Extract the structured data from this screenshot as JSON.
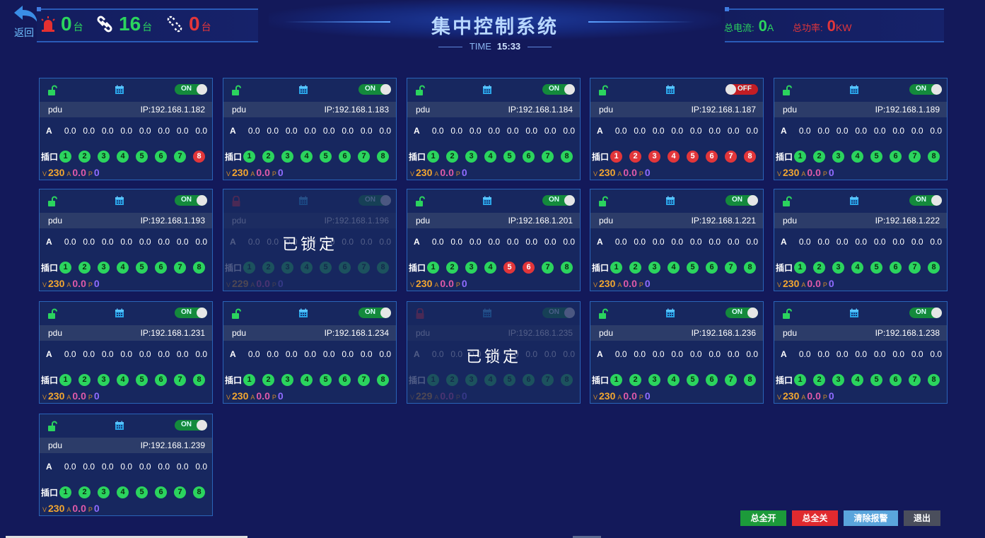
{
  "header": {
    "back_label": "返回",
    "alarm_count": "0",
    "online_count": "16",
    "offline_count": "0",
    "unit": "台",
    "title": "集中控制系统",
    "time_label": "TIME",
    "time_value": "15:33",
    "total_current_label": "总电流:",
    "total_current_value": "0",
    "total_current_unit": "A",
    "total_power_label": "总功率:",
    "total_power_value": "0",
    "total_power_unit": "KW"
  },
  "card_labels": {
    "current_row_label": "A",
    "ports_label": "插口",
    "lock_text": "已锁定",
    "v_unit": "V",
    "a_unit": "A",
    "p_unit": "P"
  },
  "devices": [
    {
      "name": "pdu",
      "ip": "IP:192.168.1.182",
      "switch": "ON",
      "locked": false,
      "currents": [
        "0.0",
        "0.0",
        "0.0",
        "0.0",
        "0.0",
        "0.0",
        "0.0",
        "0.0"
      ],
      "ports_on": [
        true,
        true,
        true,
        true,
        true,
        true,
        true,
        false
      ],
      "voltage": "230",
      "amps": "0.0",
      "power": "0"
    },
    {
      "name": "pdu",
      "ip": "IP:192.168.1.183",
      "switch": "ON",
      "locked": false,
      "currents": [
        "0.0",
        "0.0",
        "0.0",
        "0.0",
        "0.0",
        "0.0",
        "0.0",
        "0.0"
      ],
      "ports_on": [
        true,
        true,
        true,
        true,
        true,
        true,
        true,
        true
      ],
      "voltage": "230",
      "amps": "0.0",
      "power": "0"
    },
    {
      "name": "pdu",
      "ip": "IP:192.168.1.184",
      "switch": "ON",
      "locked": false,
      "currents": [
        "0.0",
        "0.0",
        "0.0",
        "0.0",
        "0.0",
        "0.0",
        "0.0",
        "0.0"
      ],
      "ports_on": [
        true,
        true,
        true,
        true,
        true,
        true,
        true,
        true
      ],
      "voltage": "230",
      "amps": "0.0",
      "power": "0"
    },
    {
      "name": "pdu",
      "ip": "IP:192.168.1.187",
      "switch": "OFF",
      "locked": false,
      "currents": [
        "0.0",
        "0.0",
        "0.0",
        "0.0",
        "0.0",
        "0.0",
        "0.0",
        "0.0"
      ],
      "ports_on": [
        false,
        false,
        false,
        false,
        false,
        false,
        false,
        false
      ],
      "voltage": "230",
      "amps": "0.0",
      "power": "0"
    },
    {
      "name": "pdu",
      "ip": "IP:192.168.1.189",
      "switch": "ON",
      "locked": false,
      "currents": [
        "0.0",
        "0.0",
        "0.0",
        "0.0",
        "0.0",
        "0.0",
        "0.0",
        "0.0"
      ],
      "ports_on": [
        true,
        true,
        true,
        true,
        true,
        true,
        true,
        true
      ],
      "voltage": "230",
      "amps": "0.0",
      "power": "0"
    },
    {
      "name": "pdu",
      "ip": "IP:192.168.1.193",
      "switch": "ON",
      "locked": false,
      "currents": [
        "0.0",
        "0.0",
        "0.0",
        "0.0",
        "0.0",
        "0.0",
        "0.0",
        "0.0"
      ],
      "ports_on": [
        true,
        true,
        true,
        true,
        true,
        true,
        true,
        true
      ],
      "voltage": "230",
      "amps": "0.0",
      "power": "0"
    },
    {
      "name": "pdu",
      "ip": "IP:192.168.1.196",
      "switch": "ON",
      "locked": true,
      "currents": [
        "0.0",
        "0.0",
        "0.0",
        "0.0",
        "0.0",
        "0.0",
        "0.0",
        "0.0"
      ],
      "ports_on": [
        true,
        true,
        true,
        true,
        true,
        true,
        true,
        true
      ],
      "voltage": "229",
      "amps": "0.0",
      "power": "0"
    },
    {
      "name": "pdu",
      "ip": "IP:192.168.1.201",
      "switch": "ON",
      "locked": false,
      "currents": [
        "0.0",
        "0.0",
        "0.0",
        "0.0",
        "0.0",
        "0.0",
        "0.0",
        "0.0"
      ],
      "ports_on": [
        true,
        true,
        true,
        true,
        false,
        false,
        true,
        true
      ],
      "voltage": "230",
      "amps": "0.0",
      "power": "0"
    },
    {
      "name": "pdu",
      "ip": "IP:192.168.1.221",
      "switch": "ON",
      "locked": false,
      "currents": [
        "0.0",
        "0.0",
        "0.0",
        "0.0",
        "0.0",
        "0.0",
        "0.0",
        "0.0"
      ],
      "ports_on": [
        true,
        true,
        true,
        true,
        true,
        true,
        true,
        true
      ],
      "voltage": "230",
      "amps": "0.0",
      "power": "0"
    },
    {
      "name": "pdu",
      "ip": "IP:192.168.1.222",
      "switch": "ON",
      "locked": false,
      "currents": [
        "0.0",
        "0.0",
        "0.0",
        "0.0",
        "0.0",
        "0.0",
        "0.0",
        "0.0"
      ],
      "ports_on": [
        true,
        true,
        true,
        true,
        true,
        true,
        true,
        true
      ],
      "voltage": "230",
      "amps": "0.0",
      "power": "0"
    },
    {
      "name": "pdu",
      "ip": "IP:192.168.1.231",
      "switch": "ON",
      "locked": false,
      "currents": [
        "0.0",
        "0.0",
        "0.0",
        "0.0",
        "0.0",
        "0.0",
        "0.0",
        "0.0"
      ],
      "ports_on": [
        true,
        true,
        true,
        true,
        true,
        true,
        true,
        true
      ],
      "voltage": "230",
      "amps": "0.0",
      "power": "0"
    },
    {
      "name": "pdu",
      "ip": "IP:192.168.1.234",
      "switch": "ON",
      "locked": false,
      "currents": [
        "0.0",
        "0.0",
        "0.0",
        "0.0",
        "0.0",
        "0.0",
        "0.0",
        "0.0"
      ],
      "ports_on": [
        true,
        true,
        true,
        true,
        true,
        true,
        true,
        true
      ],
      "voltage": "230",
      "amps": "0.0",
      "power": "0"
    },
    {
      "name": "pdu",
      "ip": "IP:192.168.1.235",
      "switch": "ON",
      "locked": true,
      "currents": [
        "0.0",
        "0.0",
        "0.0",
        "0.0",
        "0.0",
        "0.0",
        "0.0",
        "0.0"
      ],
      "ports_on": [
        true,
        true,
        true,
        true,
        true,
        true,
        true,
        true
      ],
      "voltage": "229",
      "amps": "0.0",
      "power": "0"
    },
    {
      "name": "pdu",
      "ip": "IP:192.168.1.236",
      "switch": "ON",
      "locked": false,
      "currents": [
        "0.0",
        "0.0",
        "0.0",
        "0.0",
        "0.0",
        "0.0",
        "0.0",
        "0.0"
      ],
      "ports_on": [
        true,
        true,
        true,
        true,
        true,
        true,
        true,
        true
      ],
      "voltage": "230",
      "amps": "0.0",
      "power": "0"
    },
    {
      "name": "pdu",
      "ip": "IP:192.168.1.238",
      "switch": "ON",
      "locked": false,
      "currents": [
        "0.0",
        "0.0",
        "0.0",
        "0.0",
        "0.0",
        "0.0",
        "0.0",
        "0.0"
      ],
      "ports_on": [
        true,
        true,
        true,
        true,
        true,
        true,
        true,
        true
      ],
      "voltage": "230",
      "amps": "0.0",
      "power": "0"
    },
    {
      "name": "pdu",
      "ip": "IP:192.168.1.239",
      "switch": "ON",
      "locked": false,
      "currents": [
        "0.0",
        "0.0",
        "0.0",
        "0.0",
        "0.0",
        "0.0",
        "0.0",
        "0.0"
      ],
      "ports_on": [
        true,
        true,
        true,
        true,
        true,
        true,
        true,
        true
      ],
      "voltage": "230",
      "amps": "0.0",
      "power": "0"
    }
  ],
  "footer": {
    "all_on": "总全开",
    "all_off": "总全关",
    "clear_alarm": "清除报警",
    "exit": "退出"
  },
  "colors": {
    "background": "#13195a",
    "on_green": "#2bd45e",
    "off_red": "#e2363a",
    "voltage_orange": "#f2a630",
    "amps_pink": "#e05aa8",
    "power_purple": "#8f6bff"
  }
}
